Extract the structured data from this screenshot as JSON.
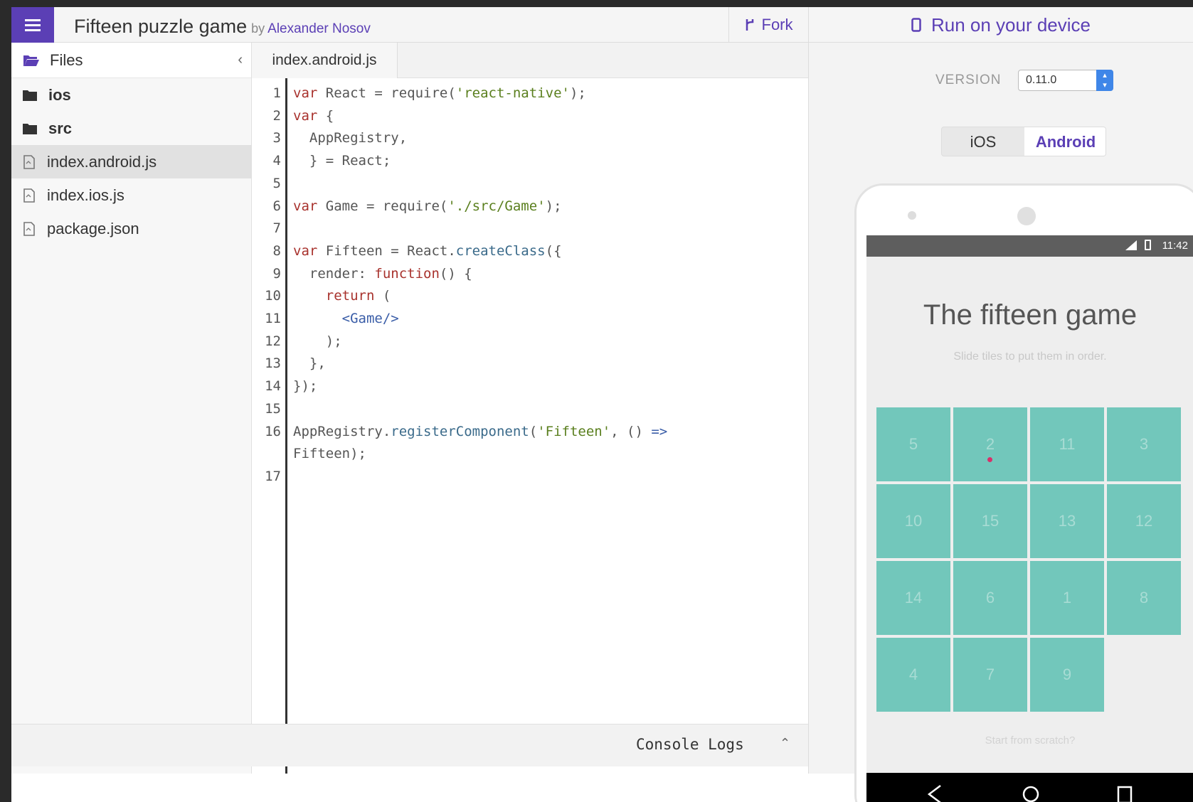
{
  "header": {
    "title": "Fifteen puzzle game",
    "by": "by",
    "author": "Alexander Nosov",
    "fork_label": "Fork",
    "run_label": "Run on your device"
  },
  "sidebar": {
    "title": "Files",
    "items": [
      {
        "type": "folder",
        "name": "ios"
      },
      {
        "type": "folder",
        "name": "src"
      },
      {
        "type": "file",
        "name": "index.android.js",
        "active": true
      },
      {
        "type": "file",
        "name": "index.ios.js"
      },
      {
        "type": "file",
        "name": "package.json"
      }
    ]
  },
  "editor": {
    "tab": "index.android.js",
    "line_numbers": [
      "1",
      "2",
      "3",
      "4",
      "5",
      "6",
      "7",
      "8",
      "9",
      "10",
      "11",
      "12",
      "13",
      "14",
      "15",
      "16",
      "17"
    ],
    "lines": [
      [
        {
          "t": "var ",
          "c": "kw"
        },
        {
          "t": "React = require(",
          "c": "plain"
        },
        {
          "t": "'react-native'",
          "c": "str"
        },
        {
          "t": ");",
          "c": "plain"
        }
      ],
      [
        {
          "t": "var ",
          "c": "kw"
        },
        {
          "t": "{",
          "c": "plain"
        }
      ],
      [
        {
          "t": "  AppRegistry,",
          "c": "plain"
        }
      ],
      [
        {
          "t": "  } = React;",
          "c": "plain"
        }
      ],
      [],
      [
        {
          "t": "var ",
          "c": "kw"
        },
        {
          "t": "Game = require(",
          "c": "plain"
        },
        {
          "t": "'./src/Game'",
          "c": "str"
        },
        {
          "t": ");",
          "c": "plain"
        }
      ],
      [],
      [
        {
          "t": "var ",
          "c": "kw"
        },
        {
          "t": "Fifteen = React.",
          "c": "plain"
        },
        {
          "t": "createClass",
          "c": "fn"
        },
        {
          "t": "({",
          "c": "plain"
        }
      ],
      [
        {
          "t": "  render: ",
          "c": "plain"
        },
        {
          "t": "function",
          "c": "kw"
        },
        {
          "t": "() {",
          "c": "plain"
        }
      ],
      [
        {
          "t": "    ",
          "c": "plain"
        },
        {
          "t": "return",
          "c": "kw"
        },
        {
          "t": " (",
          "c": "plain"
        }
      ],
      [
        {
          "t": "      ",
          "c": "plain"
        },
        {
          "t": "<Game/>",
          "c": "tag"
        }
      ],
      [
        {
          "t": "    );",
          "c": "plain"
        }
      ],
      [
        {
          "t": "  },",
          "c": "plain"
        }
      ],
      [
        {
          "t": "});",
          "c": "plain"
        }
      ],
      [],
      [
        {
          "t": "AppRegistry.",
          "c": "plain"
        },
        {
          "t": "registerComponent",
          "c": "fn"
        },
        {
          "t": "(",
          "c": "plain"
        },
        {
          "t": "'Fifteen'",
          "c": "str"
        },
        {
          "t": ", () ",
          "c": "plain"
        },
        {
          "t": "=>",
          "c": "tag"
        }
      ],
      [
        {
          "t": "Fifteen);",
          "c": "plain"
        }
      ],
      []
    ]
  },
  "console": {
    "label": "Console Logs"
  },
  "preview": {
    "version_label": "VERSION",
    "version_value": "0.11.0",
    "platforms": [
      "iOS",
      "Android"
    ],
    "selected_platform": "Android",
    "device_time": "11:42",
    "app_title": "The fifteen game",
    "app_subtitle": "Slide tiles to put them in order.",
    "tiles": [
      "5",
      "2",
      "11",
      "3",
      "10",
      "15",
      "13",
      "12",
      "14",
      "6",
      "1",
      "8",
      "4",
      "7",
      "9",
      ""
    ],
    "app_footer": "Start from scratch?"
  },
  "colors": {
    "brand": "#5b3fb5",
    "tile": "#72c7bb",
    "keyword": "#a8322d",
    "string": "#5a7f1e"
  },
  "icons": {
    "menu": "hamburger-icon",
    "fork": "fork-icon",
    "device": "phone-icon",
    "files": "folder-open-icon",
    "collapse": "chevron-left-icon",
    "folder": "folder-icon",
    "file": "file-icon"
  }
}
